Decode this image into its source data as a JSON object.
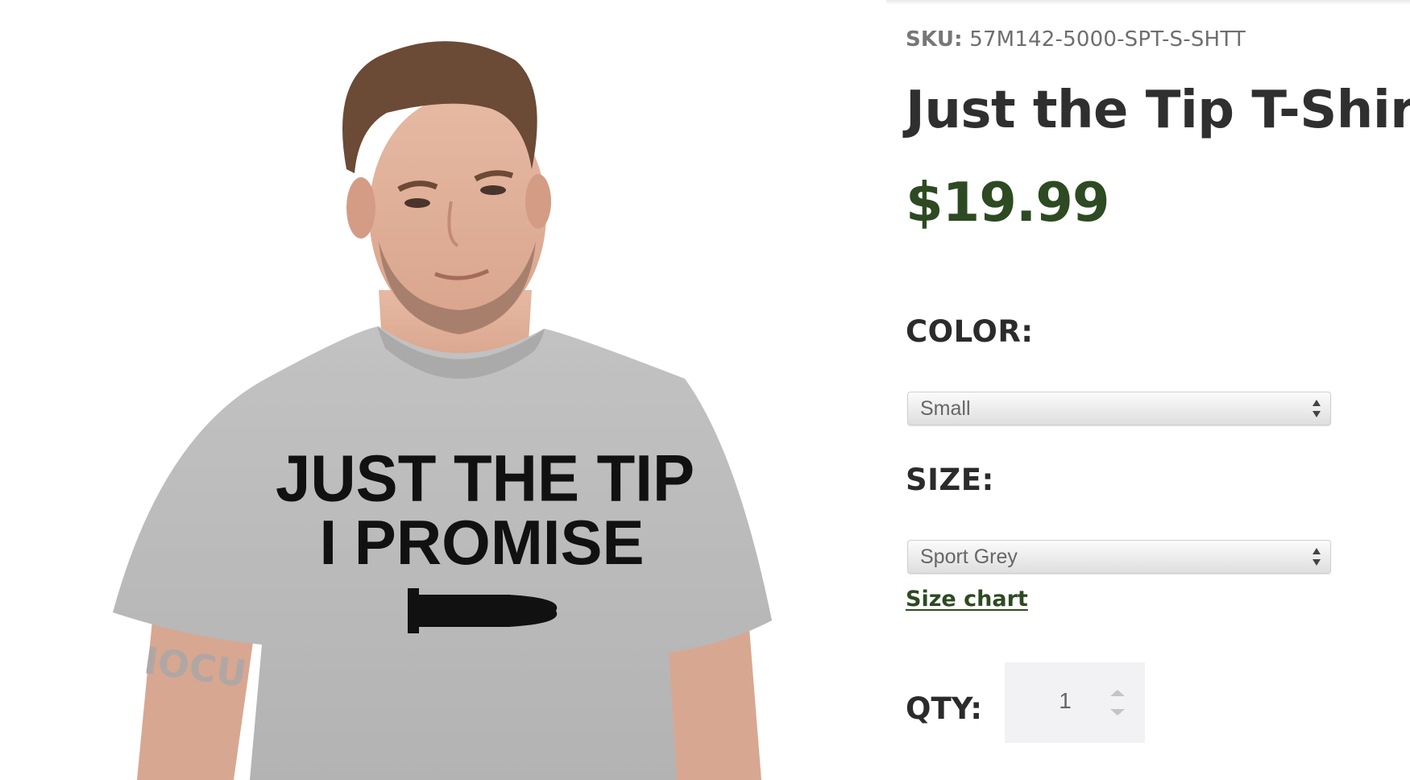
{
  "product": {
    "sku_label": "SKU:",
    "sku_value": "57M142-5000-SPT-S-SHTT",
    "title": "Just the Tip T-Shirt",
    "price": "$19.99",
    "price_color": "#2d4a22"
  },
  "shirt_print": {
    "line1": "JUST THE TIP",
    "line2": "I PROMISE"
  },
  "options": {
    "color_label": "COLOR:",
    "color_selected": "Small",
    "size_label": "SIZE:",
    "size_selected": "Sport Grey",
    "size_chart_link": "Size chart"
  },
  "quantity": {
    "label": "QTY:",
    "value": "1"
  },
  "icons": {
    "select_arrows": "up-down-caret-icon",
    "qty_stepper": "stepper-arrows-icon"
  }
}
